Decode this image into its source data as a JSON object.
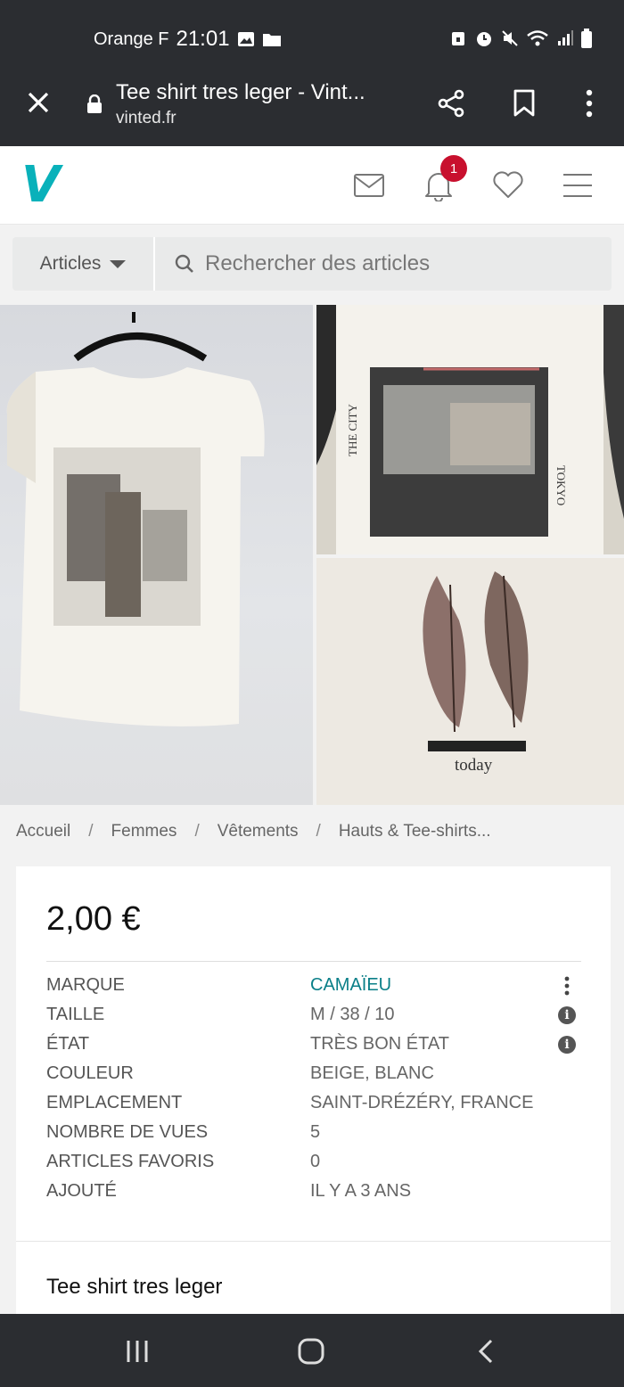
{
  "status": {
    "carrier": "Orange F",
    "time": "21:01"
  },
  "browser": {
    "page_title": "Tee shirt tres leger - Vint...",
    "domain": "vinted.fr"
  },
  "header": {
    "logo": "V",
    "notification_count": "1"
  },
  "search": {
    "category_label": "Articles",
    "placeholder": "Rechercher des articles"
  },
  "photos": {
    "p2_text_left": "THE CITY",
    "p2_text_right": "TOKYO",
    "p3_caption": "today"
  },
  "breadcrumb": [
    "Accueil",
    "Femmes",
    "Vêtements",
    "Hauts & Tee-shirts..."
  ],
  "item": {
    "price": "2,00 €",
    "details": [
      {
        "label": "MARQUE",
        "value": "CAMAÏEU"
      },
      {
        "label": "TAILLE",
        "value": "M / 38 / 10"
      },
      {
        "label": "ÉTAT",
        "value": "TRÈS BON ÉTAT"
      },
      {
        "label": "COULEUR",
        "value": "BEIGE, BLANC"
      },
      {
        "label": "EMPLACEMENT",
        "value": "SAINT-DRÉZÉRY, FRANCE"
      },
      {
        "label": "NOMBRE DE VUES",
        "value": "5"
      },
      {
        "label": "ARTICLES FAVORIS",
        "value": "0"
      },
      {
        "label": "AJOUTÉ",
        "value": "IL Y A 3 ANS"
      }
    ],
    "title": "Tee shirt tres leger"
  },
  "colors": {
    "brand": "#09b1ba",
    "badge": "#c8102e",
    "bar": "#2b2d31"
  }
}
